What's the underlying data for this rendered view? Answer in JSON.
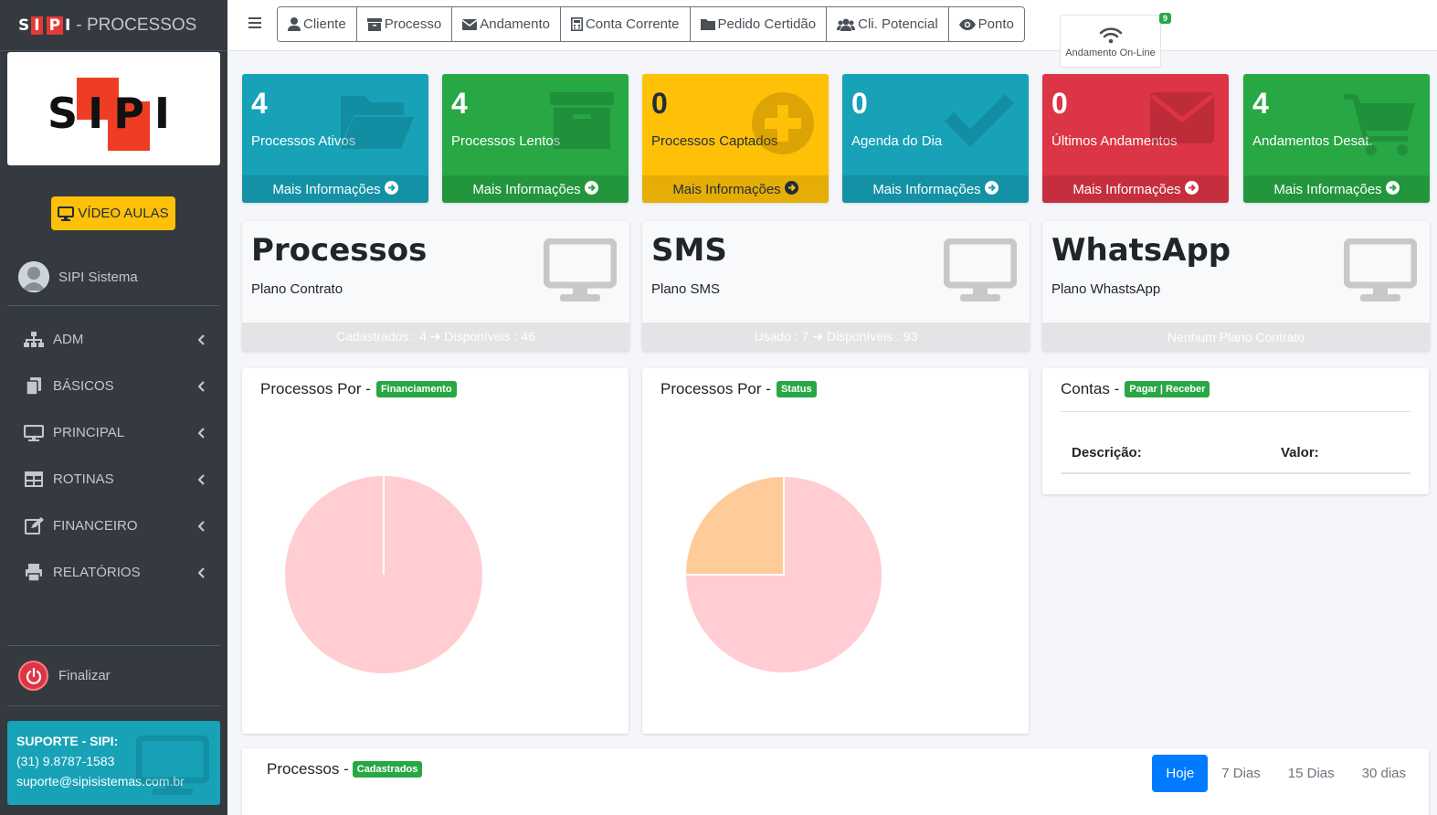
{
  "brand": {
    "logo_s": "S",
    "logo_i": "I",
    "logo_p": "P",
    "logo_i2": "I",
    "text": "- PROCESSOS"
  },
  "logo_big": {
    "text": "SIPI"
  },
  "video_button": "VÍDEO AULAS",
  "user": {
    "name": "SIPI Sistema"
  },
  "nav": [
    {
      "label": "ADM",
      "icon": "sitemap-icon"
    },
    {
      "label": "BÁSICOS",
      "icon": "copy-icon"
    },
    {
      "label": "PRINCIPAL",
      "icon": "desktop-icon"
    },
    {
      "label": "ROTINAS",
      "icon": "table-icon"
    },
    {
      "label": "FINANCEIRO",
      "icon": "edit-icon"
    },
    {
      "label": "RELATÓRIOS",
      "icon": "print-icon"
    }
  ],
  "logout_label": "Finalizar",
  "support": {
    "title": "SUPORTE - SIPI:",
    "phone": "(31) 9.8787-1583",
    "email": "suporte@sipisistemas.com.br"
  },
  "topbar": {
    "buttons": [
      {
        "label": "Cliente",
        "icon": "user-icon"
      },
      {
        "label": "Processo",
        "icon": "archive-icon"
      },
      {
        "label": "Andamento",
        "icon": "envelope-icon"
      },
      {
        "label": "Conta Corrente",
        "icon": "calculator-icon"
      },
      {
        "label": "Pedido Certidão",
        "icon": "folder-icon"
      },
      {
        "label": "Cli. Potencial",
        "icon": "users-icon"
      },
      {
        "label": "Ponto",
        "icon": "eye-icon"
      }
    ],
    "online": {
      "label": "Andamento On-Line",
      "badge": "9"
    }
  },
  "small_boxes": [
    {
      "value": "4",
      "caption": "Processos Ativos",
      "more": "Mais Informações",
      "color": "#17a2b8",
      "icon": "folder-open-icon"
    },
    {
      "value": "4",
      "caption": "Processos Lentos",
      "more": "Mais Informações",
      "color": "#28a745",
      "icon": "archive-icon"
    },
    {
      "value": "0",
      "caption": "Processos Captados",
      "more": "Mais Informações",
      "color": "#ffc107",
      "icon": "plus-circle-icon"
    },
    {
      "value": "0",
      "caption": "Agenda do Dia",
      "more": "Mais Informações",
      "color": "#17a2b8",
      "icon": "check-icon"
    },
    {
      "value": "0",
      "caption": "Últimos Andamentos",
      "more": "Mais Informações",
      "color": "#dc3545",
      "icon": "envelope-icon"
    },
    {
      "value": "4",
      "caption": "Andamentos Desat.",
      "more": "Mais Informações",
      "color": "#28a745",
      "icon": "cart-icon"
    }
  ],
  "info_cards": [
    {
      "title": "Processos",
      "subtitle": "Plano Contrato",
      "footer": "Cadastrados : 4 ➔ Disponíveis : 46"
    },
    {
      "title": "SMS",
      "subtitle": "Plano SMS",
      "footer": "Usado : 7 ➔ Disponíveis : 93"
    },
    {
      "title": "WhatsApp",
      "subtitle": "Plano WhastsApp",
      "footer": "Nenhum Plano Contrato"
    }
  ],
  "chart_cards": {
    "financiamento": {
      "title": "Processos Por -",
      "tag": "Financiamento"
    },
    "status": {
      "title": "Processos Por -",
      "tag": "Status"
    },
    "contas": {
      "title": "Contas -",
      "tag": "Pagar | Receber",
      "col1": "Descrição:",
      "col2": "Valor:"
    }
  },
  "chart_data": [
    {
      "type": "pie",
      "title": "",
      "values": [
        100
      ],
      "colors": [
        "#ffcdd2"
      ]
    },
    {
      "type": "pie",
      "title": "",
      "values": [
        75,
        25
      ],
      "colors": [
        "#ffcdd2",
        "#ffcc99"
      ]
    }
  ],
  "bottom_card": {
    "title": "Processos -",
    "tag": "Cadastrados",
    "ranges": [
      "Hoje",
      "7 Dias",
      "15 Dias",
      "30 dias"
    ],
    "active_range": "Hoje"
  },
  "colors": {
    "sidebar": "#343a40",
    "primary": "#007bff",
    "info": "#17a2b8",
    "success": "#28a745",
    "warning": "#ffc107",
    "danger": "#dc3545"
  }
}
